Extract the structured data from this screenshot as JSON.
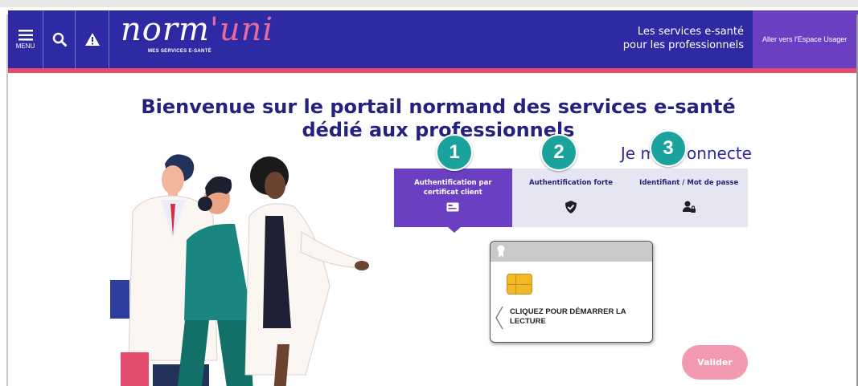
{
  "header": {
    "menu_label": "MENU",
    "logo_main": "norm",
    "logo_accent": "'uni",
    "logo_sub": "MES SERVICES E-SANTÉ",
    "tagline_line1": "Les services e-santé",
    "tagline_line2": "pour les professionnels",
    "espace_usager": "Aller vers l'Espace Usager",
    "colors": {
      "header_bg": "#2e2aa3",
      "header_stripe": "#e34b6f",
      "espace_bg": "#6a3fc2"
    }
  },
  "main": {
    "title_line1": "Bienvenue sur le portail normand des services e-santé",
    "title_line2": "dédié aux professionnels"
  },
  "connect": {
    "title_start": "Je m",
    "title_end": "onnecte",
    "badges": [
      "1",
      "2",
      "3"
    ],
    "tabs": [
      {
        "label": "Authentification par certificat client",
        "icon": "id-card-icon",
        "active": true
      },
      {
        "label": "Authentification forte",
        "icon": "shield-check-icon",
        "active": false
      },
      {
        "label": "Identifiant / Mot de passe",
        "icon": "user-lock-icon",
        "active": false
      }
    ]
  },
  "card": {
    "text": "CLIQUEZ POUR DÉMARRER LA LECTURE"
  },
  "validate_label": "Valider"
}
